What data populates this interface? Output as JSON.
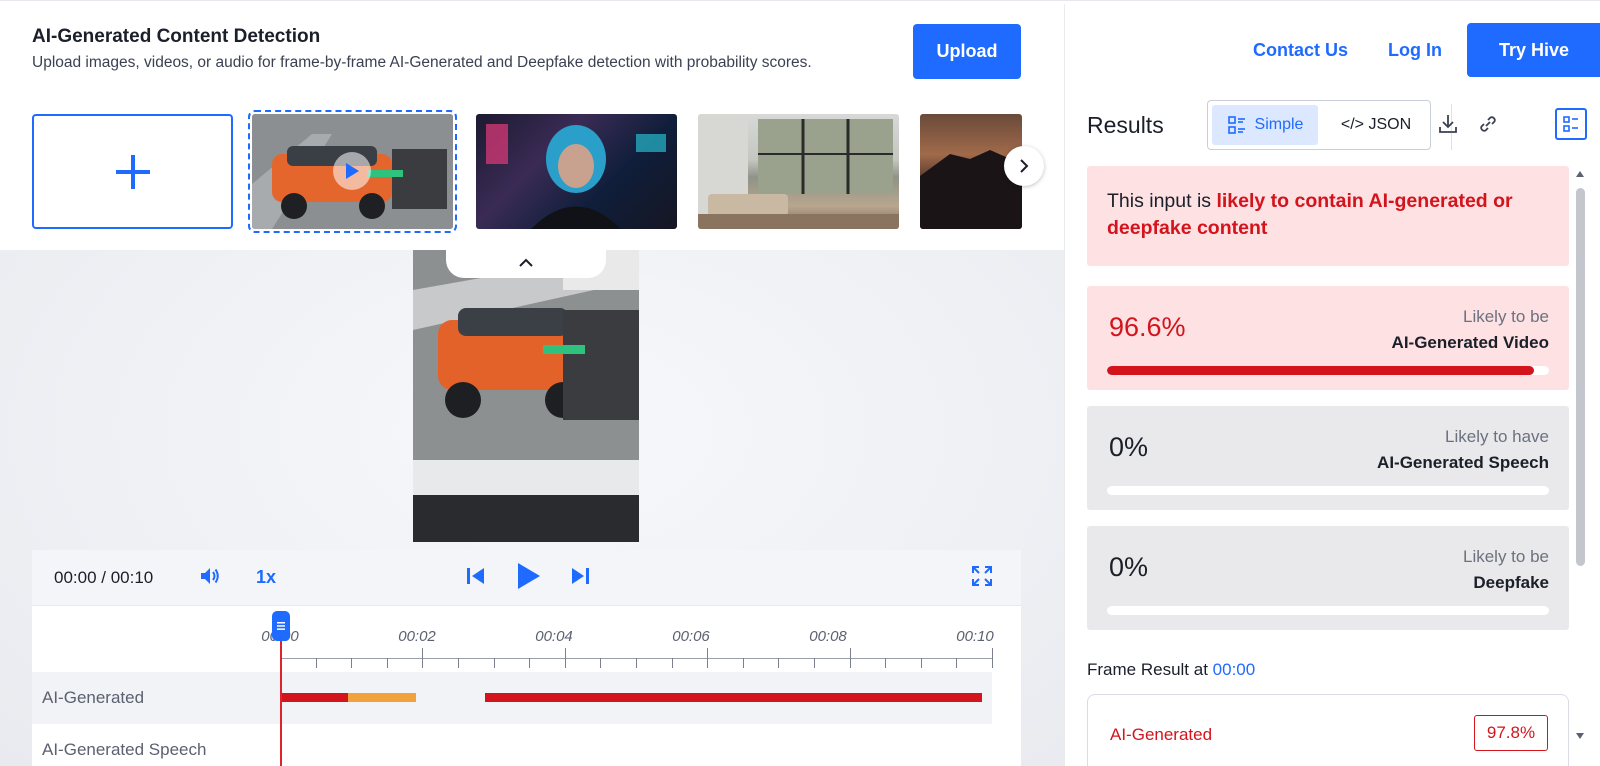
{
  "header": {
    "title": "AI-Generated Content Detection",
    "subtitle": "Upload images, videos, or audio for frame-by-frame AI-Generated and Deepfake detection with probability scores.",
    "upload_label": "Upload"
  },
  "nav": {
    "contact_label": "Contact Us",
    "login_label": "Log In",
    "try_label": "Try Hive"
  },
  "player": {
    "time": "00:00 / 00:10",
    "speed": "1x"
  },
  "timeline": {
    "ticks": [
      "00:00",
      "00:02",
      "00:04",
      "00:06",
      "00:08",
      "00:10"
    ],
    "tracks": [
      "AI-Generated",
      "AI-Generated Speech"
    ]
  },
  "results": {
    "title": "Results",
    "view_simple": "Simple",
    "view_json": "</> JSON",
    "verdict_prefix": "This input is ",
    "verdict_highlight": "likely to contain AI-generated or deepfake content",
    "scores": [
      {
        "value": "96.6%",
        "fraction": 0.966,
        "cap1": "Likely to be",
        "cap2": "AI-Generated Video"
      },
      {
        "value": "0%",
        "fraction": 0,
        "cap1": "Likely to have",
        "cap2": "AI-Generated Speech"
      },
      {
        "value": "0%",
        "fraction": 0,
        "cap1": "Likely to be",
        "cap2": "Deepfake"
      }
    ],
    "frame_prefix": "Frame Result at ",
    "frame_time": "00:00",
    "frame_label": "AI-Generated",
    "frame_value": "97.8%"
  },
  "colors": {
    "accent": "#1f6bff",
    "danger": "#d4141c",
    "warning": "#f2a23c"
  }
}
